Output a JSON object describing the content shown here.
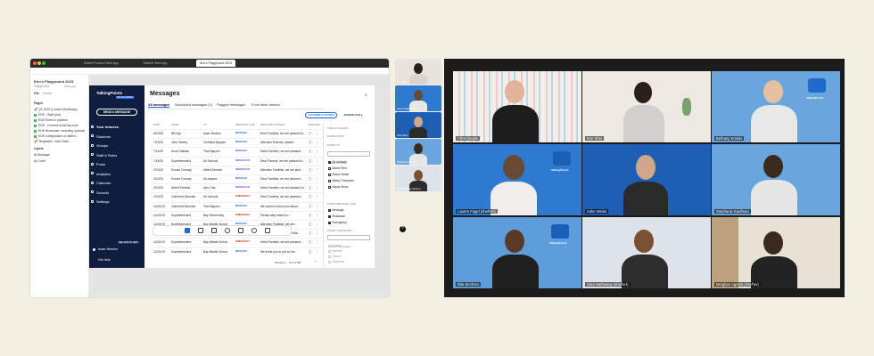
{
  "figma": {
    "tabs": [
      "District Product Web App",
      "Teacher Web App",
      "Erin's Playground 2023"
    ],
    "project_title": "Erin's Playground 2023",
    "project_sub": "Playground",
    "panel_tabs": [
      "File",
      "Assets"
    ],
    "pages_label": "Pages",
    "pages": [
      "🚀 Q1 2023 (Comms Roadmap)",
      "ENE - Staff (Aid)",
      "ENE Roles in pipeline",
      "ENE - Connect email account",
      "ENE Broadcast: recording optional",
      "ENE configuration of district...",
      "🚀 Templates - Add: Edits"
    ],
    "layers_label": "Layers",
    "layers": [
      "Message",
      "Cover"
    ],
    "frame_label": "Messages",
    "help": "?"
  },
  "app": {
    "brand": "TalkingPoints",
    "brand_sub": "PROGRAMMER",
    "send_button": "SEND A MESSAGE",
    "nav": [
      "Your inboxes",
      "Students",
      "Groups",
      "Staff & Roles",
      "Posts",
      "Analytics",
      "Calendar",
      "Schools",
      "Settings"
    ],
    "new_badge": "SEE WHAT'S NEW",
    "user": "Isaac Newton",
    "get_help": "Get help",
    "title": "Messages",
    "tabs": [
      "All messages",
      "Scheduled messages (2)",
      "Flagged messages",
      "From other admins"
    ],
    "columns_button": "COLUMNS & FILTERS",
    "download_button": "DOWNLOAD",
    "headers": [
      "DATE",
      "FROM",
      "TO",
      "MESSAGE TYPE",
      "MESSAGE CONTENT",
      "DELIVERY"
    ],
    "rows": [
      {
        "date": "8/10/20",
        "from": "Bill Nye",
        "to": "Isaac Newton",
        "type": "MESSAGE",
        "type_color": "#2d5bd6",
        "content": "Dear Families, we are pleased to..."
      },
      {
        "date": "7/15/20",
        "from": "John Dewey",
        "to": "Christina Nguyen",
        "type": "MESSAGE",
        "type_color": "#2d5bd6",
        "content": "Attention Parents, please..."
      },
      {
        "date": "7/14/20",
        "from": "Anne Sullivan",
        "to": "Tina Nguyen",
        "type": "MESSAGE",
        "type_color": "#2d5bd6",
        "content": "Hello Families, we are pleased..."
      },
      {
        "date": "7/14/20",
        "from": "Superintendent",
        "to": "All Schools",
        "type": "BROADCAST",
        "type_color": "#7a3cc9",
        "content": "Dear Parents, we are pleased to..."
      },
      {
        "date": "2/10/20",
        "from": "Eunice Conway",
        "to": "Albert Einstein",
        "type": "BROADCAST",
        "type_color": "#7a3cc9",
        "content": "Attention Families, we are plea..."
      },
      {
        "date": "2/10/20",
        "from": "Eunice Conway",
        "to": "All classes",
        "type": "MESSAGE",
        "type_color": "#2d5bd6",
        "content": "Dear Families, we are pleased..."
      },
      {
        "date": "2/10/20",
        "from": "Albert Einstein",
        "to": "Alex Chin",
        "type": "BROADCAST",
        "type_color": "#7a3cc9",
        "content": "Hello Families, we are pleased to..."
      },
      {
        "date": "1/10/20",
        "from": "Catherine Beecher",
        "to": "All Schools",
        "type": "EMERGENCY",
        "type_color": "#d22c2c",
        "content": "Dear Families, we are pleased..."
      },
      {
        "date": "12/10/19",
        "from": "Catherine Beecher",
        "to": "Tina Nguyen",
        "type": "MESSAGE",
        "type_color": "#2d5bd6",
        "content": "We want to inform you about..."
      },
      {
        "date": "12/10/19",
        "from": "Superintendent",
        "to": "Bay Elementary",
        "type": "EMERGENCY",
        "type_color": "#d22c2c",
        "content": "Please stay tuned for...."
      },
      {
        "date": "12/10/19",
        "from": "Superintendent",
        "to": "Bay Middle School",
        "type": "MESSAGE",
        "type_color": "#2d5bd6",
        "content": "Attention Families, we are..."
      },
      {
        "date": "12/10/19",
        "from": "Superintendent",
        "to": "Bay Middle School",
        "type": "BROADCAST",
        "type_color": "#7a3cc9",
        "content": "Dear Families, we would like..."
      },
      {
        "date": "12/10/19",
        "from": "Superintendent",
        "to": "Bay Middle School",
        "type": "EMERGENCY",
        "type_color": "#d22c2c",
        "content": "Hello Families, we are pleased..."
      },
      {
        "date": "12/10/19",
        "from": "Superintendent",
        "to": "Bay Middle School",
        "type": "MESSAGE",
        "type_color": "#2d5bd6",
        "content": "We invite you to join us for..."
      }
    ],
    "pagination": "Showing 1 - 10 of 2,305",
    "filters": {
      "title": "TABLE COLUMNS",
      "from_label": "FILTER FROM",
      "to_label": "FILTER TO",
      "search_people": "Search people",
      "people": [
        {
          "name": "All contacts",
          "checked": true
        },
        {
          "name": "Aimee Shin",
          "checked": false
        },
        {
          "name": "Andra Takaki",
          "checked": false
        },
        {
          "name": "Bailey Thompson",
          "checked": false
        },
        {
          "name": "Baylor Burns",
          "checked": false
        }
      ],
      "type_label": "FILTER MESSAGE TYPE",
      "types": [
        {
          "name": "Message",
          "checked": true
        },
        {
          "name": "Broadcast",
          "checked": true
        },
        {
          "name": "Emergency",
          "checked": true
        }
      ],
      "lang_label": "FILTER LANGUAGES",
      "search_lang": "Search languages",
      "languages": [
        "English",
        "Spanish",
        "French",
        "Japanese"
      ]
    }
  },
  "thumbnails": [
    "Erin Shin",
    "Lauren Fogel (she/her)",
    "Anke Weiss",
    "Stephanie Kaufman",
    "Sara Hathaway (she/her)"
  ],
  "gallery": {
    "brand_text": "TalkingPoints",
    "participants": [
      "Chris Dudek",
      "Erin Shin",
      "Bethany Knisler",
      "Lauren Fogel (she/her)",
      "Anke Weiss",
      "Stephanie Kaufman",
      "Rita Kirchner",
      "Sara Hathaway (she/her)",
      "Meighan Agosta (she/her)"
    ]
  }
}
